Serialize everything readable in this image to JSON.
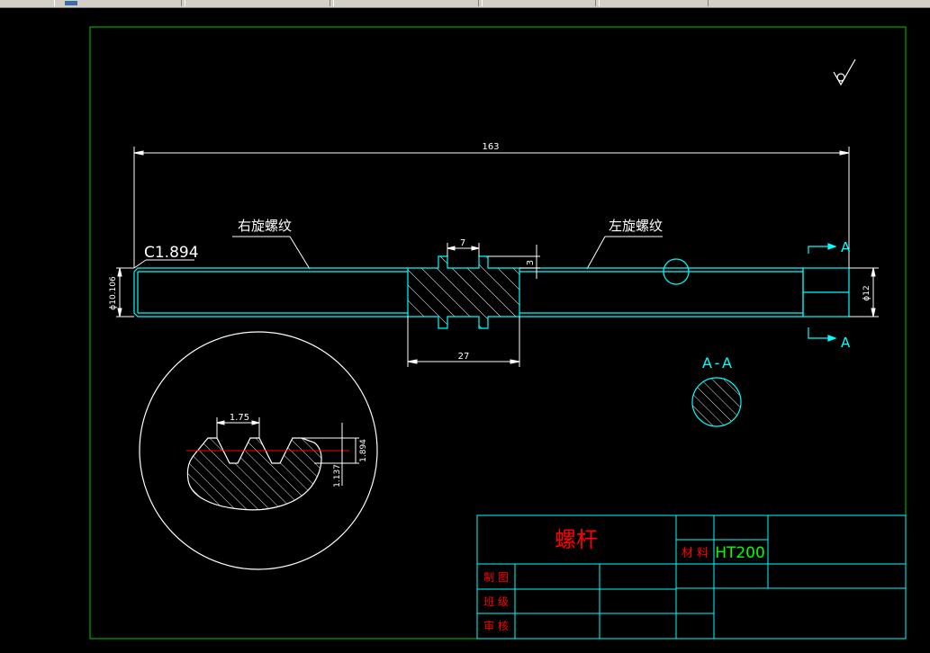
{
  "colors": {
    "border": "#00c800",
    "part": "#00ffff",
    "dimension": "#ffffff",
    "title": "#ff0000",
    "material": "#00ff00",
    "hatch": "#ffffff",
    "centerline": "#ff0000"
  },
  "drawing": {
    "overall_length": "163",
    "chamfer_label": "C1.894",
    "right_thread_label": "右旋螺纹",
    "left_thread_label": "左旋螺纹",
    "left_diameter": "ϕ10.106",
    "right_diameter": "ϕ12",
    "gear_tooth_width": "7",
    "gear_tooth_height": "3",
    "gear_length": "27",
    "section_mark": "A",
    "section_title": "A-A",
    "detail_pitch": "1.75",
    "detail_depth": "1.894",
    "detail_root": "1.137",
    "surface_finish_icon": "surface-roughness-icon"
  },
  "title_block": {
    "part_name": "螺杆",
    "material_label": "材 料",
    "material_value": "HT200",
    "drawn_by_label": "制 图",
    "class_label": "班 级",
    "check_label": "审 核"
  }
}
